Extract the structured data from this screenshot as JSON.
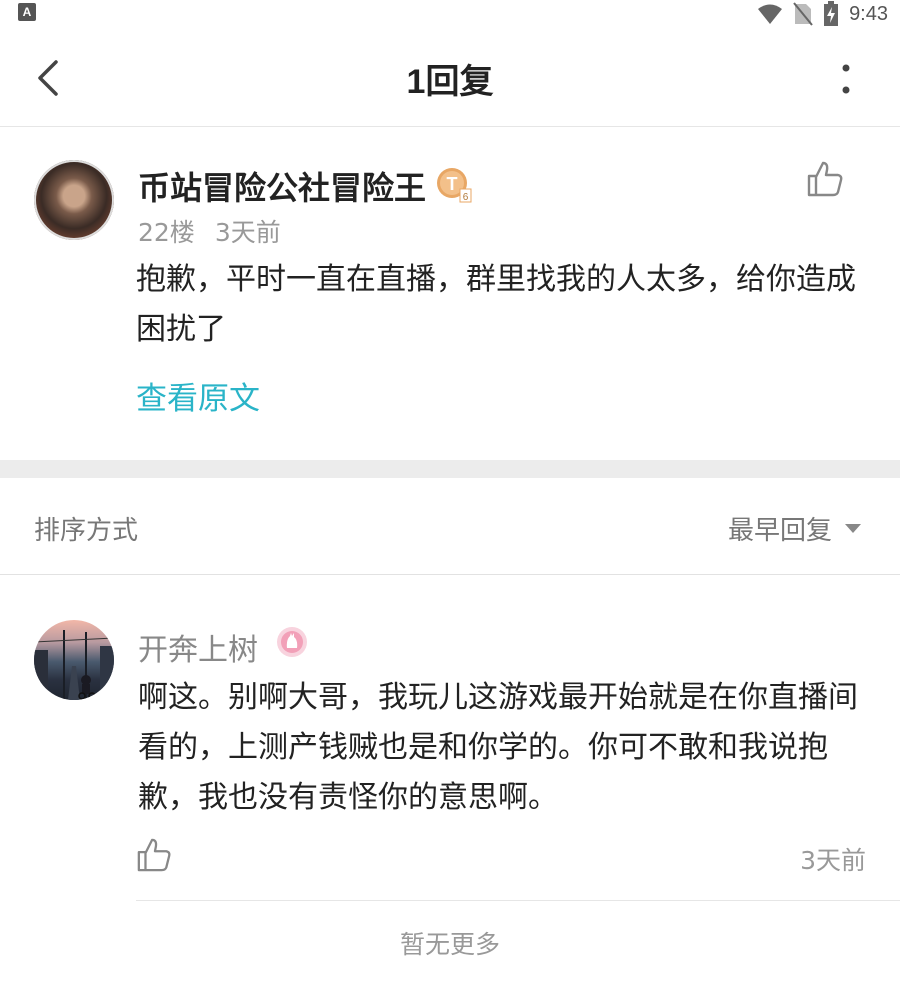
{
  "status_bar": {
    "app_icon_letter": "A",
    "time": "9:43"
  },
  "header": {
    "title": "1回复"
  },
  "main_post": {
    "author": "币站冒险公社冒险王",
    "floor": "22楼",
    "time": "3天前",
    "text": "抱歉，平时一直在直播，群里找我的人太多，给你造成困扰了",
    "view_original": "查看原文",
    "badge_letter": "T",
    "badge_level": "6"
  },
  "sort": {
    "label": "排序方式",
    "value": "最早回复"
  },
  "reply": {
    "author": "开奔上树",
    "text": "啊这。别啊大哥，我玩儿这游戏最开始就是在你直播间看的，上测产钱贼也是和你学的。你可不敢和我说抱歉，我也没有责怪你的意思啊。",
    "time": "3天前"
  },
  "footer": {
    "no_more": "暂无更多"
  },
  "colors": {
    "accent": "#2ab4c8",
    "badge_gold": "#e8a765",
    "badge_pink": "#f2a0b8"
  }
}
